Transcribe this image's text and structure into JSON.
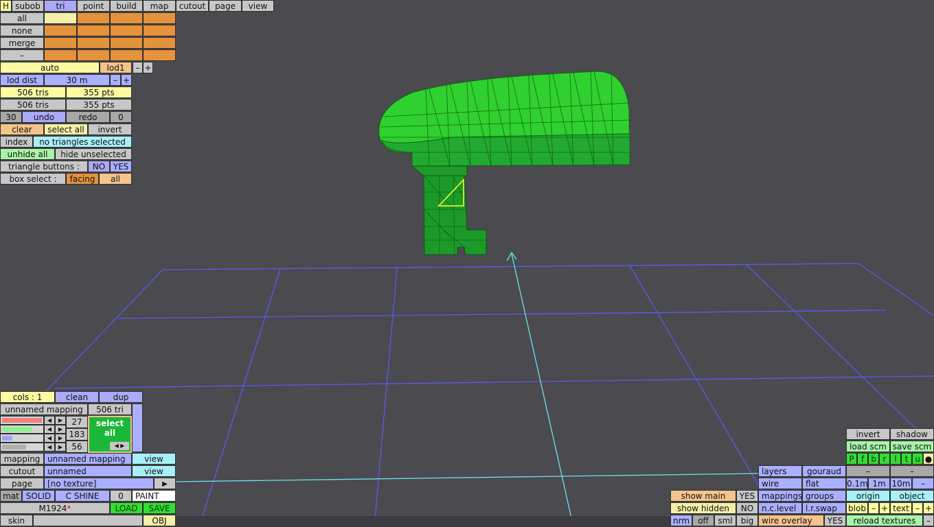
{
  "tabs": {
    "h": "H",
    "subob": "subob",
    "tri": "tri",
    "point": "point",
    "build": "build",
    "map": "map",
    "cutout": "cutout",
    "page": "page",
    "view": "view"
  },
  "selection_rows": {
    "all": "all",
    "none": "none",
    "merge": "merge",
    "minus": "–"
  },
  "lod": {
    "auto": "auto",
    "level": "lod1",
    "minus": "–",
    "plus": "+",
    "dist_label": "lod dist",
    "dist_value": "30 m"
  },
  "counts": {
    "tris1": "506 tris",
    "pts1": "355 pts",
    "tris2": "506 tris",
    "pts2": "355 pts"
  },
  "undo_row": {
    "steps": "30",
    "undo": "undo",
    "redo": "redo",
    "redo_count": "0"
  },
  "edit_row": {
    "clear": "clear",
    "select_all": "select all",
    "invert": "invert"
  },
  "index_row": {
    "index": "index",
    "status": "no triangles selected"
  },
  "hide_row": {
    "unhide_all": "unhide all",
    "hide_unselected": "hide unselected"
  },
  "tri_buttons": {
    "label": "triangle buttons :",
    "no": "NO",
    "yes": "YES"
  },
  "box_select": {
    "label": "box select :",
    "facing": "facing",
    "all": "all"
  },
  "cols_row": {
    "cols": "cols : 1",
    "clean": "clean",
    "dup": "dup"
  },
  "mapping_header": {
    "name": "unnamed mapping",
    "tri": "506 tri"
  },
  "color_values": {
    "r": "27",
    "g": "183",
    "b": "56"
  },
  "swatch": {
    "label": "select all",
    "color": "#1bb738"
  },
  "mapping_row": {
    "label": "mapping",
    "value": "unnamed mapping",
    "view": "view"
  },
  "cutout_row": {
    "label": "cutout",
    "value": "unnamed",
    "view": "view"
  },
  "page_row": {
    "label": "page",
    "value": "[no texture]",
    "arrow": "▶"
  },
  "material_row": {
    "mat": "mat",
    "solid": "SOLID",
    "shine": "C SHINE",
    "num": "0",
    "paint": "PAINT"
  },
  "model_row": {
    "name": "M1924",
    "star": "*",
    "load": "LOAD",
    "save": "SAVE"
  },
  "skin_row": {
    "skin": "skin",
    "obj": "OBJ"
  },
  "right_panel": {
    "invert": "invert",
    "shadow": "shadow",
    "load_scm": "load scm",
    "save_scm": "save scm",
    "letters": [
      "P",
      "f",
      "b",
      "r",
      "l",
      "t",
      "u",
      "●"
    ],
    "layers": "layers",
    "gouraud": "gouraud",
    "dash1": "–",
    "dash2": "–",
    "wire": "wire",
    "flat": "flat",
    "d01": "0.1m",
    "d1": "1m",
    "d10": "10m",
    "dminus": "–",
    "mappings": "mappings",
    "groups": "groups",
    "origin": "origin",
    "object": "object",
    "nclevel": "n.c.level",
    "lrswap": "l.r.swap",
    "blob": "blob",
    "bminus": "–",
    "bplus": "+",
    "text": "text",
    "tminus": "–",
    "tplus": "+",
    "wire_overlay": "wire overlay",
    "wo_yes": "YES",
    "reload": "reload textures",
    "rminus": "–"
  },
  "bottom_left_right": {
    "show_main": "show main",
    "show_main_yes": "YES",
    "show_hidden": "show hidden",
    "show_hidden_no": "NO",
    "nrm": "nrm",
    "off": "off",
    "sml": "sml",
    "big": "big"
  },
  "colors": {
    "mesh": "#2fd02f",
    "mesh_dark": "#1f9a2a",
    "grid": "#5555ee",
    "axis": "#66e6e6",
    "selected_tri": "#ffff33",
    "background": "#4a4a4f"
  }
}
